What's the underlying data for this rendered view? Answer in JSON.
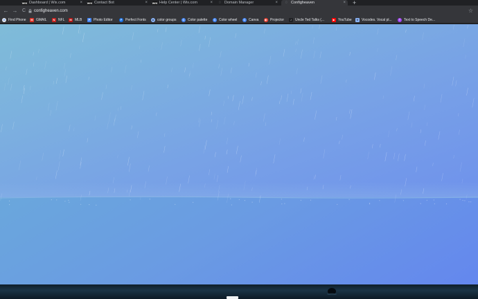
{
  "tabs": [
    {
      "title": "Dashboard | Wix.com",
      "icon": "wix-icon",
      "fav": "WIX"
    },
    {
      "title": "Contact Bot",
      "icon": "wix-icon",
      "fav": "WIX"
    },
    {
      "title": "Help Center | Wix.com",
      "icon": "wix-icon",
      "fav": "WIX"
    },
    {
      "title": "Domain Manager",
      "icon": "loading-icon",
      "fav": "◌"
    },
    {
      "title": "Configheaven",
      "icon": "configheaven-icon",
      "fav": "◌",
      "active": true
    }
  ],
  "new_tab_symbol": "+",
  "close_symbol": "×",
  "omnibox": {
    "url": "configheaven.com",
    "star": "☆"
  },
  "nav": {
    "back": "←",
    "forward": "→",
    "reload": "C"
  },
  "bookmarks": [
    {
      "label": "Find Phone",
      "icon": "google-circle-icon",
      "color": "#e8eaed",
      "glyph": "G"
    },
    {
      "label": "GMAIL",
      "icon": "gmail-icon",
      "color": "#d93025",
      "glyph": "M"
    },
    {
      "label": "NFL",
      "icon": "nfl-icon",
      "color": "#c5221f",
      "glyph": "N"
    },
    {
      "label": "MLB",
      "icon": "mlb-icon",
      "color": "#b31412",
      "glyph": "M"
    },
    {
      "label": "Photo Editor",
      "icon": "photo-editor-icon",
      "color": "#4285f4",
      "glyph": "P"
    },
    {
      "label": "Perfect Fonts",
      "icon": "perfect-fonts-icon",
      "color": "#1a73e8",
      "glyph": "F"
    },
    {
      "label": "color groups",
      "icon": "color-groups-icon",
      "color": "#8ab4f8",
      "glyph": "c"
    },
    {
      "label": "Color palette",
      "icon": "color-palette-icon",
      "color": "#4285f4",
      "glyph": "C"
    },
    {
      "label": "Color wheel",
      "icon": "color-wheel-icon",
      "color": "#4285f4",
      "glyph": "C"
    },
    {
      "label": "Canva",
      "icon": "canva-icon",
      "color": "#4285f4",
      "glyph": "C"
    },
    {
      "label": "Projector",
      "icon": "projector-icon",
      "color": "#ea4335",
      "glyph": "▶"
    },
    {
      "label": "Uncle Ted Talks (...",
      "icon": "tiktok-icon",
      "color": "#202124",
      "glyph": "♪"
    },
    {
      "label": "YouTube",
      "icon": "youtube-icon",
      "color": "#ff0000",
      "glyph": "▶"
    },
    {
      "label": "Vocodes. Vocal pl...",
      "icon": "vocodes-icon",
      "color": "#8ab4f8",
      "glyph": "V"
    },
    {
      "label": "Text to Speech De...",
      "icon": "tts-icon",
      "color": "#a142f4",
      "glyph": "T"
    }
  ],
  "colors": {
    "sky_top": "#7fbcd8",
    "sky_bottom": "#6f92ec",
    "sea": "#6487ee",
    "ground": "#0f1f2a",
    "chrome_bg": "#35363a"
  }
}
